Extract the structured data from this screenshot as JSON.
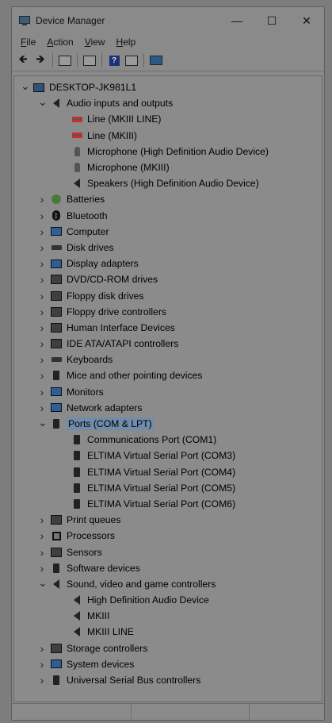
{
  "window": {
    "title": "Device Manager",
    "buttons": {
      "minimize": "—",
      "maximize": "☐",
      "close": "✕"
    }
  },
  "menu": [
    "File",
    "Action",
    "View",
    "Help"
  ],
  "toolbar": {
    "back": "🡸",
    "forward": "🡺"
  },
  "tree": [
    {
      "label": "DESKTOP-JK981L1",
      "depth": 0,
      "state": "expanded",
      "icon": "computer-icon"
    },
    {
      "label": "Audio inputs and outputs",
      "depth": 1,
      "state": "expanded",
      "icon": "speaker-icon"
    },
    {
      "label": "Line (MKIII LINE)",
      "depth": 2,
      "state": "leaf",
      "icon": "line-jack-icon"
    },
    {
      "label": "Line (MKIII)",
      "depth": 2,
      "state": "leaf",
      "icon": "line-jack-icon"
    },
    {
      "label": "Microphone (High Definition Audio Device)",
      "depth": 2,
      "state": "leaf",
      "icon": "microphone-icon"
    },
    {
      "label": "Microphone (MKIII)",
      "depth": 2,
      "state": "leaf",
      "icon": "microphone-icon"
    },
    {
      "label": "Speakers (High Definition Audio Device)",
      "depth": 2,
      "state": "leaf",
      "icon": "speaker-icon"
    },
    {
      "label": "Batteries",
      "depth": 1,
      "state": "collapsed",
      "icon": "battery-icon"
    },
    {
      "label": "Bluetooth",
      "depth": 1,
      "state": "collapsed",
      "icon": "bluetooth-icon"
    },
    {
      "label": "Computer",
      "depth": 1,
      "state": "collapsed",
      "icon": "monitor-icon"
    },
    {
      "label": "Disk drives",
      "depth": 1,
      "state": "collapsed",
      "icon": "disk-drive-icon"
    },
    {
      "label": "Display adapters",
      "depth": 1,
      "state": "collapsed",
      "icon": "display-adapter-icon"
    },
    {
      "label": "DVD/CD-ROM drives",
      "depth": 1,
      "state": "collapsed",
      "icon": "dvd-drive-icon"
    },
    {
      "label": "Floppy disk drives",
      "depth": 1,
      "state": "collapsed",
      "icon": "floppy-drive-icon"
    },
    {
      "label": "Floppy drive controllers",
      "depth": 1,
      "state": "collapsed",
      "icon": "floppy-controller-icon"
    },
    {
      "label": "Human Interface Devices",
      "depth": 1,
      "state": "collapsed",
      "icon": "hid-icon"
    },
    {
      "label": "IDE ATA/ATAPI controllers",
      "depth": 1,
      "state": "collapsed",
      "icon": "ide-controller-icon"
    },
    {
      "label": "Keyboards",
      "depth": 1,
      "state": "collapsed",
      "icon": "keyboard-icon"
    },
    {
      "label": "Mice and other pointing devices",
      "depth": 1,
      "state": "collapsed",
      "icon": "mouse-icon"
    },
    {
      "label": "Monitors",
      "depth": 1,
      "state": "collapsed",
      "icon": "monitor-icon"
    },
    {
      "label": "Network adapters",
      "depth": 1,
      "state": "collapsed",
      "icon": "network-adapter-icon"
    },
    {
      "label": "Ports (COM & LPT)",
      "depth": 1,
      "state": "expanded",
      "icon": "port-icon",
      "selected": true
    },
    {
      "label": "Communications Port (COM1)",
      "depth": 2,
      "state": "leaf",
      "icon": "port-icon"
    },
    {
      "label": "ELTIMA Virtual Serial Port (COM3)",
      "depth": 2,
      "state": "leaf",
      "icon": "port-icon"
    },
    {
      "label": "ELTIMA Virtual Serial Port (COM4)",
      "depth": 2,
      "state": "leaf",
      "icon": "port-icon"
    },
    {
      "label": "ELTIMA Virtual Serial Port (COM5)",
      "depth": 2,
      "state": "leaf",
      "icon": "port-icon"
    },
    {
      "label": "ELTIMA Virtual Serial Port (COM6)",
      "depth": 2,
      "state": "leaf",
      "icon": "port-icon"
    },
    {
      "label": "Print queues",
      "depth": 1,
      "state": "collapsed",
      "icon": "printer-icon"
    },
    {
      "label": "Processors",
      "depth": 1,
      "state": "collapsed",
      "icon": "processor-icon"
    },
    {
      "label": "Sensors",
      "depth": 1,
      "state": "collapsed",
      "icon": "sensor-icon"
    },
    {
      "label": "Software devices",
      "depth": 1,
      "state": "collapsed",
      "icon": "software-device-icon"
    },
    {
      "label": "Sound, video and game controllers",
      "depth": 1,
      "state": "expanded",
      "icon": "speaker-icon"
    },
    {
      "label": "High Definition Audio Device",
      "depth": 2,
      "state": "leaf",
      "icon": "speaker-icon"
    },
    {
      "label": "MKIII",
      "depth": 2,
      "state": "leaf",
      "icon": "speaker-icon"
    },
    {
      "label": "MKIII LINE",
      "depth": 2,
      "state": "leaf",
      "icon": "speaker-icon"
    },
    {
      "label": "Storage controllers",
      "depth": 1,
      "state": "collapsed",
      "icon": "storage-controller-icon"
    },
    {
      "label": "System devices",
      "depth": 1,
      "state": "collapsed",
      "icon": "system-device-icon"
    },
    {
      "label": "Universal Serial Bus controllers",
      "depth": 1,
      "state": "collapsed",
      "icon": "usb-icon"
    }
  ],
  "colors": {
    "selection": "#6f8cab",
    "background": "#8b8b8b"
  }
}
